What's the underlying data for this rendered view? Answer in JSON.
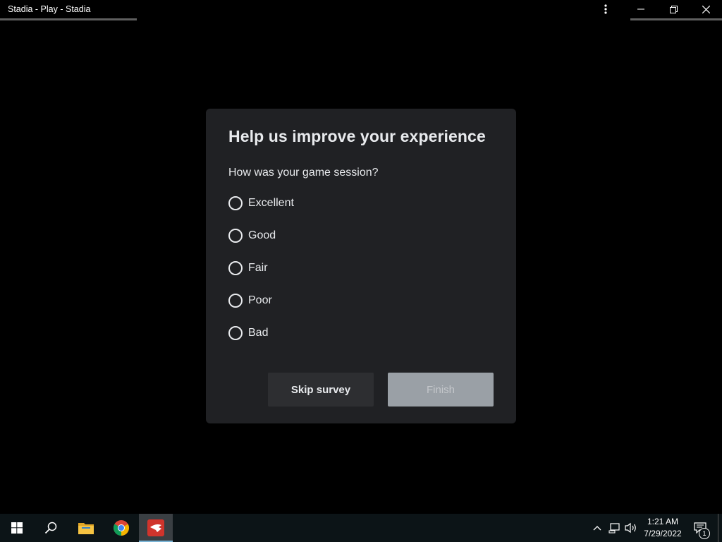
{
  "window": {
    "title": "Stadia - Play - Stadia"
  },
  "dialog": {
    "title": "Help us improve your experience",
    "question": "How was your game session?",
    "options": [
      {
        "label": "Excellent",
        "selected": false
      },
      {
        "label": "Good",
        "selected": false
      },
      {
        "label": "Fair",
        "selected": false
      },
      {
        "label": "Poor",
        "selected": false
      },
      {
        "label": "Bad",
        "selected": false
      }
    ],
    "skip_label": "Skip survey",
    "finish_label": "Finish",
    "finish_enabled": false
  },
  "taskbar": {
    "apps": [
      {
        "name": "start",
        "icon": "windows-logo-icon"
      },
      {
        "name": "search",
        "icon": "search-icon"
      },
      {
        "name": "file-explorer",
        "icon": "folder-icon"
      },
      {
        "name": "chrome",
        "icon": "chrome-icon"
      },
      {
        "name": "stadia",
        "icon": "stadia-icon",
        "active": true
      }
    ],
    "time": "1:21 AM",
    "date": "7/29/2022",
    "notification_count": "1"
  },
  "colors": {
    "background": "#000000",
    "dialog_bg": "#202124",
    "dialog_text": "#e8eaed",
    "skip_button_bg": "#2d2e31",
    "finish_button_bg": "#9aa0a6",
    "taskbar_bg": "#0c1417",
    "stadia_brand": "#e83a2e"
  }
}
